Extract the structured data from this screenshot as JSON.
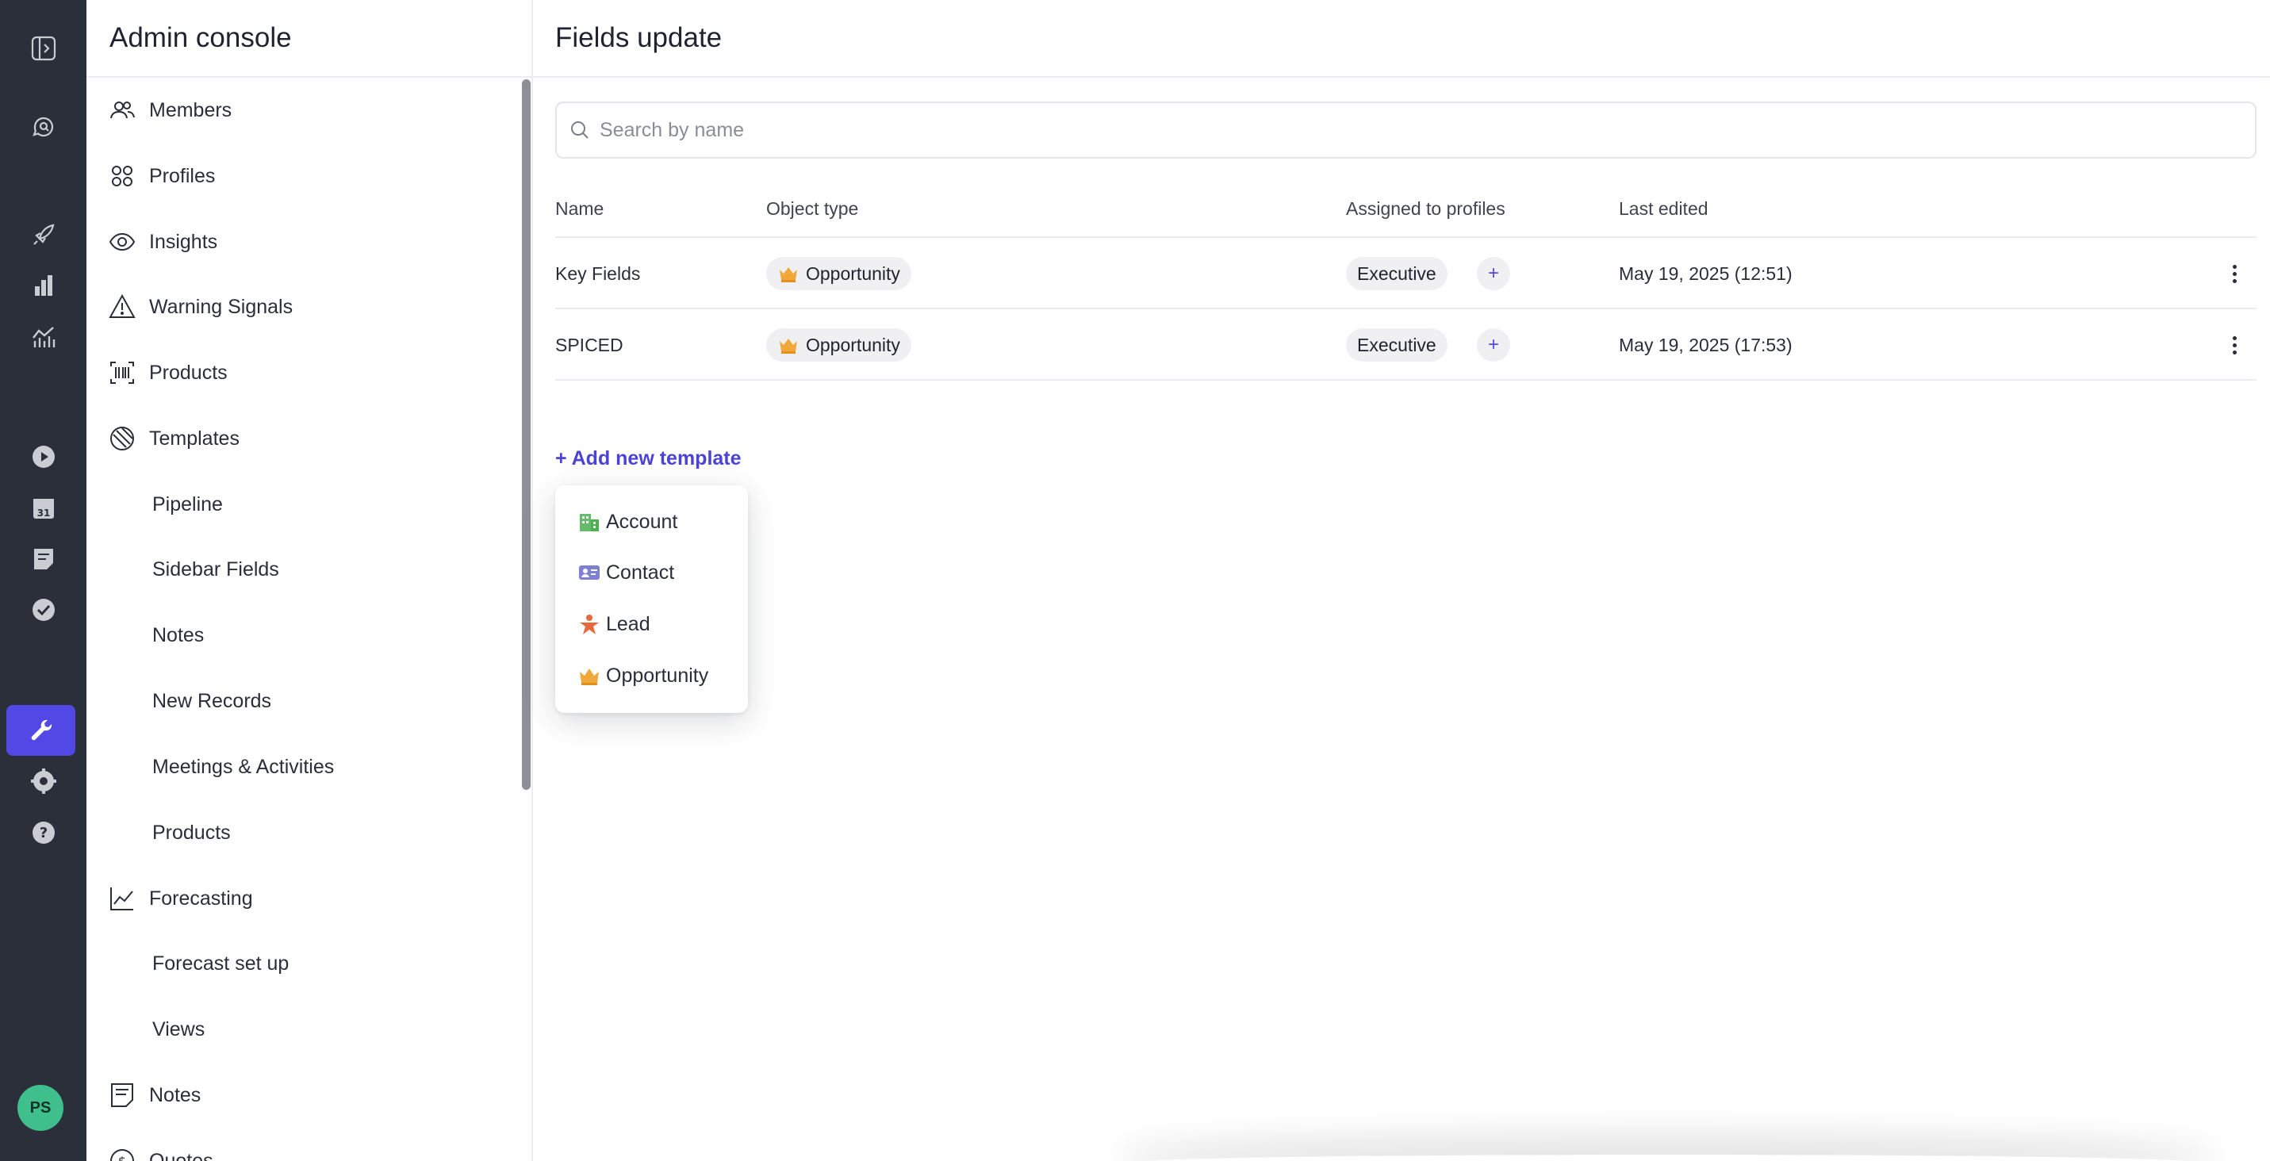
{
  "rail": {
    "avatar_initials": "PS",
    "icons": [
      "sidebar-toggle-icon",
      "search-chat-icon",
      "rocket-icon",
      "bar-chart-icon",
      "line-chart-icon",
      "play-icon",
      "calendar-icon",
      "notes-icon",
      "check-circle-icon",
      "wrench-icon",
      "gear-icon",
      "help-icon"
    ],
    "calendar_day": "31",
    "active_color": "#5148e5"
  },
  "sidebar": {
    "title": "Admin console",
    "items": [
      {
        "label": "Members",
        "icon": "members-icon"
      },
      {
        "label": "Profiles",
        "icon": "profiles-icon"
      },
      {
        "label": "Insights",
        "icon": "eye-icon"
      },
      {
        "label": "Warning Signals",
        "icon": "warning-icon"
      },
      {
        "label": "Products",
        "icon": "barcode-icon"
      },
      {
        "label": "Templates",
        "icon": "templates-icon"
      },
      {
        "label": "Pipeline"
      },
      {
        "label": "Sidebar Fields"
      },
      {
        "label": "Notes"
      },
      {
        "label": "New Records"
      },
      {
        "label": "Meetings & Activities"
      },
      {
        "label": "Products"
      },
      {
        "label": "Forecasting",
        "icon": "forecast-chart-icon"
      },
      {
        "label": "Forecast set up"
      },
      {
        "label": "Views"
      },
      {
        "label": "Notes",
        "icon": "notes-doc-icon"
      },
      {
        "label": "Quotes",
        "icon": "quotes-icon"
      }
    ]
  },
  "main": {
    "title": "Fields update",
    "search": {
      "placeholder": "Search by name",
      "value": ""
    },
    "table": {
      "headers": [
        "Name",
        "Object type",
        "Assigned to profiles",
        "Last edited"
      ],
      "rows": [
        {
          "name": "Key Fields",
          "object_type": "Opportunity",
          "profile": "Executive",
          "add": "+",
          "last_edited": "May 19, 2025 (12:51)"
        },
        {
          "name": "SPICED",
          "object_type": "Opportunity",
          "profile": "Executive",
          "add": "+",
          "last_edited": "May 19, 2025 (17:53)"
        }
      ]
    },
    "add_template_label": "+ Add new template",
    "dropdown": [
      {
        "label": "Account",
        "icon": "account-building-icon",
        "color": "#4caf50"
      },
      {
        "label": "Contact",
        "icon": "contact-card-icon",
        "color": "#6f72c9"
      },
      {
        "label": "Lead",
        "icon": "lead-person-icon",
        "color": "#e56a3d"
      },
      {
        "label": "Opportunity",
        "icon": "crown-icon",
        "color": "#f0a83a"
      }
    ]
  }
}
